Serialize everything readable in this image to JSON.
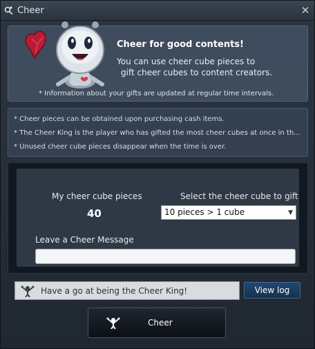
{
  "window": {
    "title": "Cheer",
    "close_symbol": "✕"
  },
  "banner": {
    "title": "Cheer for good contents!",
    "desc_line1": "You can use cheer cube pieces to",
    "desc_line2": "gift cheer cubes to content creators.",
    "note": "* Information about your gifts are updated at regular time intervals."
  },
  "notes": [
    "* Cheer pieces can be obtained upon purchasing cash items.",
    "* The Cheer King is the player who has gifted the most cheer cubes at once in th...",
    "* Unused cheer cube pieces disappear when the time is over."
  ],
  "form": {
    "pieces_label": "My cheer cube pieces",
    "pieces_value": "40",
    "select_label": "Select the cheer cube to gift",
    "select_value": "10 pieces > 1 cube",
    "message_label": "Leave a Cheer Message",
    "message_value": ""
  },
  "king_bar": {
    "text": "Have a go at being the Cheer King!"
  },
  "buttons": {
    "view_log": "View log",
    "cheer": "Cheer"
  },
  "icons": {
    "title": "cheer-app-icon",
    "mascot": "robot-mascot-with-heart-cube",
    "king": "cheering-person-icon",
    "cheer": "cheering-person-icon"
  },
  "colors": {
    "accent_blue": "#23486d",
    "panel": "#2f3946",
    "heart_cube": "#c0203a"
  }
}
